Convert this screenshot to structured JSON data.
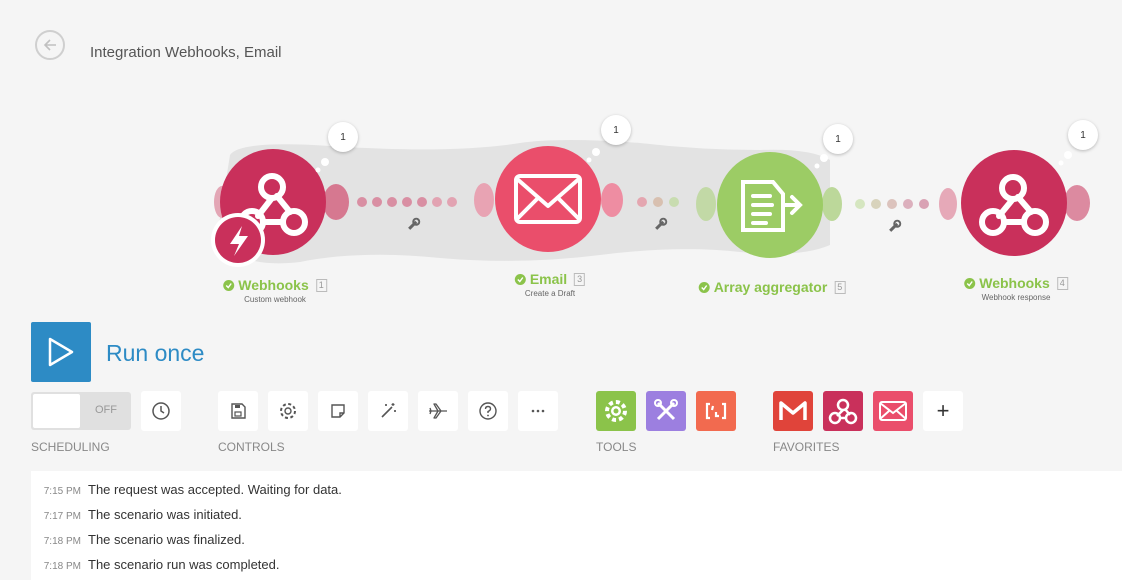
{
  "header": {
    "title": "Integration Webhooks, Email"
  },
  "modules": [
    {
      "name": "Webhooks",
      "id": "1",
      "subtitle": "Custom webhook",
      "icon": "webhook-icon",
      "color": "#c9305b",
      "ops": "1"
    },
    {
      "name": "Email",
      "id": "3",
      "subtitle": "Create a Draft",
      "icon": "envelope-icon",
      "color": "#ea4e6b",
      "ops": "1"
    },
    {
      "name": "Array aggregator",
      "id": "5",
      "subtitle": "",
      "icon": "aggregator-icon",
      "color": "#9ccc65",
      "ops": "1"
    },
    {
      "name": "Webhooks",
      "id": "4",
      "subtitle": "Webhook response",
      "icon": "webhook-icon",
      "color": "#c9305b",
      "ops": "1"
    }
  ],
  "run": {
    "label": "Run once"
  },
  "scheduling": {
    "toggle_label": "OFF",
    "section_label": "SCHEDULING"
  },
  "controls": {
    "section_label": "CONTROLS",
    "buttons": [
      "save-icon",
      "gear-icon",
      "note-icon",
      "magic-wand-icon",
      "airplane-icon",
      "help-icon",
      "more-icon"
    ]
  },
  "tools": {
    "section_label": "TOOLS",
    "items": [
      {
        "icon": "flow-control-gear-icon",
        "color": "#8bc34a"
      },
      {
        "icon": "tools-icon",
        "color": "#9c7fe0"
      },
      {
        "icon": "text-parser-icon",
        "color": "#f26a4f"
      }
    ]
  },
  "favorites": {
    "section_label": "FAVORITES",
    "items": [
      {
        "icon": "gmail-icon",
        "color": "#e0443a"
      },
      {
        "icon": "webhook-icon",
        "color": "#c9305b"
      },
      {
        "icon": "email-icon",
        "color": "#ea4e6b"
      }
    ],
    "add_label": "+"
  },
  "log": [
    {
      "time": "7:15 PM",
      "message": "The request was accepted. Waiting for data."
    },
    {
      "time": "7:17 PM",
      "message": "The scenario was initiated."
    },
    {
      "time": "7:18 PM",
      "message": "The scenario was finalized."
    },
    {
      "time": "7:18 PM",
      "message": "The scenario run was completed."
    }
  ]
}
